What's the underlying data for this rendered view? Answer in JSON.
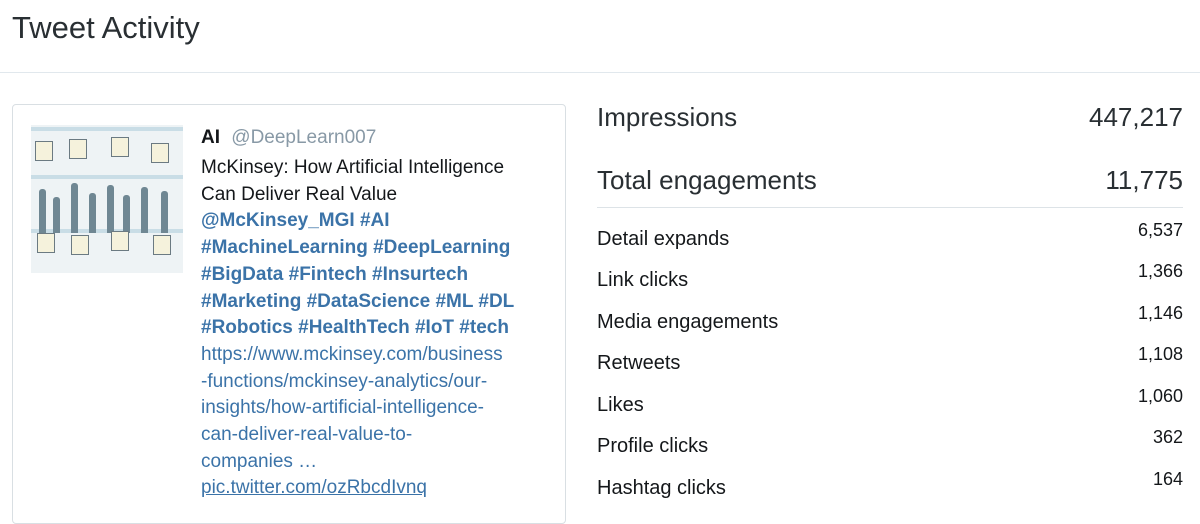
{
  "page": {
    "title": "Tweet Activity"
  },
  "tweet": {
    "author_name": "AI",
    "author_handle": "@DeepLearn007",
    "text_lines": [
      "McKinsey: How Artificial Intelligence",
      "Can Deliver Real Value"
    ],
    "hashtag_lines": [
      "@McKinsey_MGI #AI",
      "#MachineLearning #DeepLearning",
      "#BigData #Fintech #Insurtech",
      "#Marketing #DataScience #ML #DL",
      "#Robotics #HealthTech #IoT #tech"
    ],
    "link_lines": [
      "https://www.mckinsey.com/business",
      "-functions/mckinsey-analytics/our-",
      "insights/how-artificial-intelligence-",
      "can-deliver-real-value-to-",
      "companies …"
    ],
    "pic_link": "pic.twitter.com/ozRbcdIvnq"
  },
  "metrics": {
    "impressions": {
      "label": "Impressions",
      "value": "447,217"
    },
    "total_engagements": {
      "label": "Total engagements",
      "value": "11,775"
    },
    "rows": [
      {
        "label": "Detail expands",
        "value": "6,537"
      },
      {
        "label": "Link clicks",
        "value": "1,366"
      },
      {
        "label": "Media engagements",
        "value": "1,146"
      },
      {
        "label": "Retweets",
        "value": "1,108"
      },
      {
        "label": "Likes",
        "value": "1,060"
      },
      {
        "label": "Profile clicks",
        "value": "362"
      },
      {
        "label": "Hashtag clicks",
        "value": "164"
      }
    ]
  }
}
